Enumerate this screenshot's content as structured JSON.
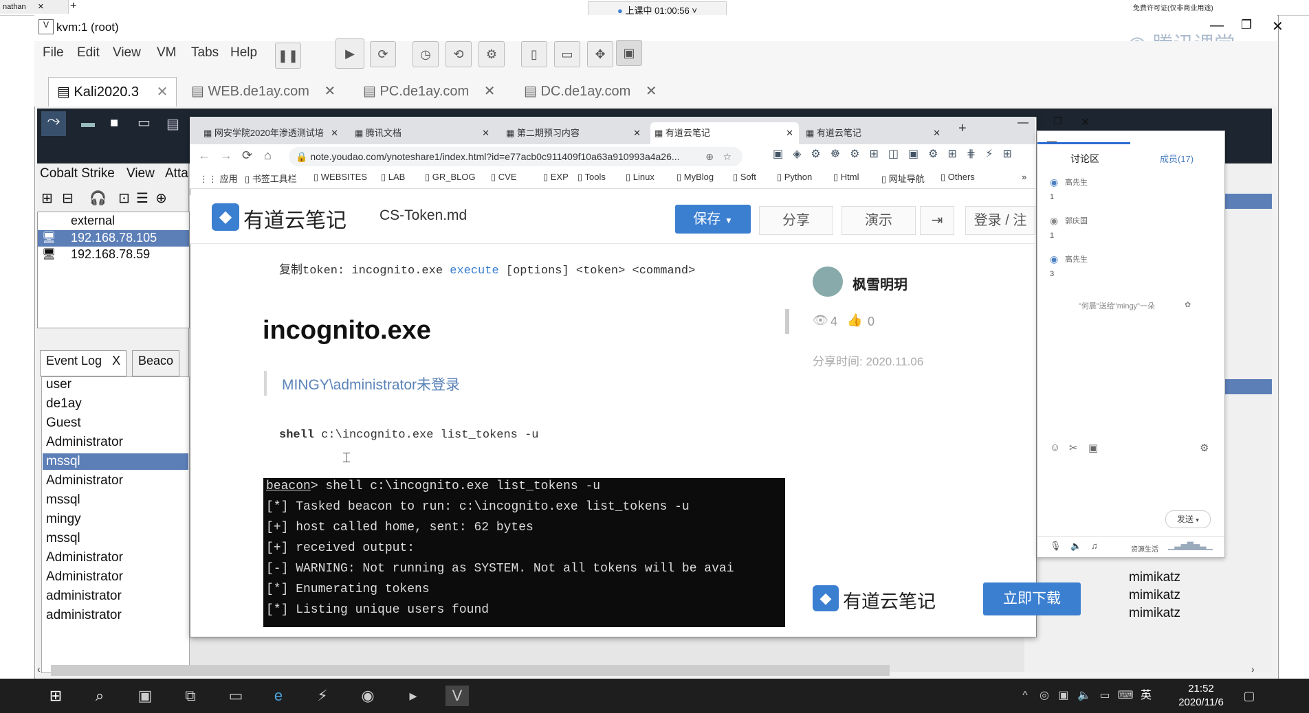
{
  "host": {
    "tab_label": "nathan",
    "live_status": "上课中 01:00:56",
    "live_chevron": "˅",
    "top_right_text": "免费许可证(仅非商业用途)",
    "tencent_logo": "腾讯课堂"
  },
  "vm": {
    "window_title": "kvm:1 (root)",
    "menu": [
      "File",
      "Edit",
      "View",
      "VM",
      "Tabs",
      "Help"
    ],
    "tabs": [
      {
        "label": "Kali2020.3",
        "active": true
      },
      {
        "label": "WEB.de1ay.com",
        "active": false
      },
      {
        "label": "PC.de1ay.com",
        "active": false
      },
      {
        "label": "DC.de1ay.com",
        "active": false
      }
    ],
    "close_glyph": "✕"
  },
  "cs": {
    "menu": [
      "Cobalt Strike",
      "View",
      "Atta"
    ],
    "table_header": "external",
    "targets": [
      "192.168.78.105",
      "192.168.78.59"
    ],
    "tabs": [
      "Event Log",
      "Beaco"
    ],
    "tab_close": "X",
    "users": [
      "user",
      "de1ay",
      "Guest",
      "Administrator",
      "mssql",
      "Administrator",
      "mssql",
      "mingy",
      "mssql",
      "Administrator",
      "Administrator",
      "administrator",
      "administrator"
    ],
    "selected_user_index": 4,
    "right_col": [
      "mimikatz",
      "mimikatz",
      "mimikatz"
    ]
  },
  "browser": {
    "tabs": [
      {
        "label": "网安学院2020年渗透测试培",
        "active": false
      },
      {
        "label": "腾讯文档",
        "active": false
      },
      {
        "label": "第二期预习内容",
        "active": false
      },
      {
        "label": "有道云笔记",
        "active": true
      },
      {
        "label": "有道云笔记",
        "active": false
      }
    ],
    "new_tab": "+",
    "url": "note.youdao.com/ynoteshare1/index.html?id=e77acb0c911409f10a63a910993a4a26...",
    "bookmarks": [
      "应用",
      "书签工具栏",
      "WEBSITES",
      "LAB",
      "GR_BLOG",
      "CVE",
      "EXP",
      "Tools",
      "Linux",
      "MyBlog",
      "Soft",
      "Python",
      "Html",
      "网址导航",
      "Others"
    ],
    "more": "»"
  },
  "youdao": {
    "brand": "有道云笔记",
    "filename": "CS-Token.md",
    "save": "保存",
    "share": "分享",
    "present": "演示",
    "login": "登录 / 注",
    "copy_line_prefix": "复制token: incognito.exe ",
    "copy_line_kw": "execute",
    "copy_line_rest": " [options] <token> <command>",
    "heading": "incognito.exe",
    "quote": "MINGY\\administrator未登录",
    "cmd_kw": "shell",
    "cmd_rest": " c:\\incognito.exe list_tokens -u",
    "author": "枫雪明玥",
    "views": "4",
    "likes": "0",
    "share_time": "分享时间: 2020.11.06",
    "download": "立即下载"
  },
  "terminal": {
    "prompt": "beacon",
    "prompt_rest": "> shell c:\\incognito.exe list_tokens -u",
    "lines": [
      "[*] Tasked beacon to run: c:\\incognito.exe list_tokens -u",
      "[+] host called home, sent: 62 bytes",
      "[+] received output:",
      "[-] WARNING: Not running as SYSTEM. Not all tokens will be avai",
      "[*] Enumerating tokens",
      "[*] Listing unique users found"
    ]
  },
  "chat": {
    "tab_discuss": "讨论区",
    "tab_members": "成员(17)",
    "entries": [
      {
        "name": "高先生",
        "msg": "1"
      },
      {
        "name": "郭庆国",
        "msg": "1"
      },
      {
        "name": "高先生",
        "msg": "3"
      }
    ],
    "gift": "\"何晨\"送给\"mingy\"一朵",
    "send": "发送",
    "footer": "资源生活"
  },
  "taskbar": {
    "time": "21:52",
    "date": "2020/11/6",
    "ime": "英"
  }
}
